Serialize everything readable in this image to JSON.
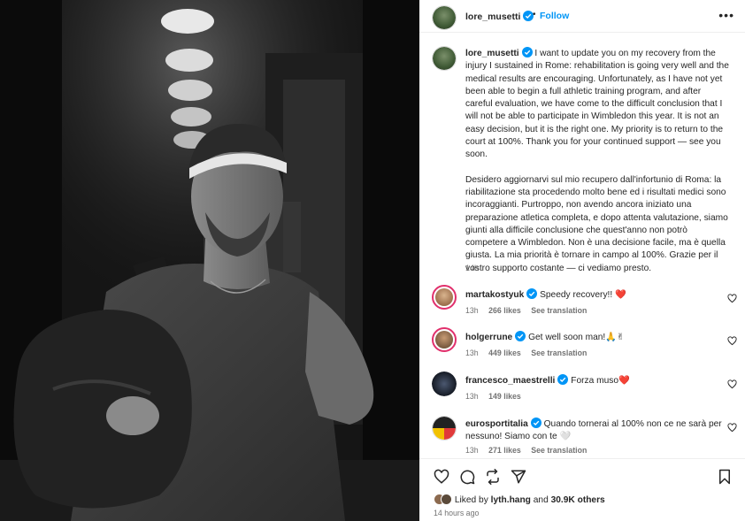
{
  "post": {
    "username": "lore_musetti",
    "follow_label": "Follow",
    "more_label": "•••",
    "photo_alt": "Black and white photo of a tennis player carrying a racket bag in a stadium corridor"
  },
  "caption": {
    "username": "lore_musetti",
    "text_en": "I want to update you on my recovery from the injury I sustained in Rome: rehabilitation is going very well and the medical results are encouraging. Unfortunately, as I have not yet been able to begin a full athletic training program, and after careful evaluation, we have come to the difficult conclusion that I will not be able to participate in Wimbledon this year. It is not an easy decision, but it is the right one. My priority is to return to the court at 100%. Thank you for your continued support — see you soon.",
    "text_it": "Desidero aggiornarvi sul mio recupero dall'infortunio di Roma: la riabilitazione sta procedendo molto bene ed i risultati medici sono incoraggianti. Purtroppo, non avendo ancora iniziato una preparazione atletica completa, e dopo attenta valutazione, siamo giunti alla difficile conclusione che quest'anno non potrò competere a Wimbledon. Non è una decisione facile, ma è quella giusta. La mia priorità è tornare in campo al 100%. Grazie per il vostro supporto costante — ci vediamo presto.",
    "time": "14h"
  },
  "comments": [
    {
      "username": "martakostyuk",
      "text": "Speedy recovery!! ❤️",
      "time": "13h",
      "likes": "266 likes",
      "translate": "See translation",
      "avatar_color": "#c9a27e",
      "ring": true
    },
    {
      "username": "holgerrune",
      "text": "Get well soon man!🙏✌",
      "time": "13h",
      "likes": "449 likes",
      "translate": "See translation",
      "avatar_color": "#b0845f",
      "ring": true
    },
    {
      "username": "francesco_maestrelli",
      "text": "Forza muso❤️",
      "time": "13h",
      "likes": "149 likes",
      "translate": "",
      "avatar_color": "#1c2230",
      "ring": false
    },
    {
      "username": "eurosportitalia",
      "text": "Quando tornerai al 100% non ce ne sarà per nessuno! Siamo con te 🤍",
      "time": "13h",
      "likes": "271 likes",
      "translate": "See translation",
      "avatar_color": "#222222",
      "ring": false
    }
  ],
  "footer": {
    "liked_by_prefix": "Liked by ",
    "liked_by_user": "lyth.hang",
    "liked_by_and": " and ",
    "liked_by_count": "30.9K others",
    "time_ago": "14 hours ago"
  },
  "icons": [
    "heart-icon",
    "comment-icon",
    "repost-icon",
    "share-icon",
    "bookmark-icon",
    "verified-icon",
    "more-icon"
  ],
  "colors": {
    "accent": "#0095f6",
    "verified": "#0095f6",
    "text": "#262626",
    "muted": "#737373",
    "heart_red": "#ed4956"
  }
}
